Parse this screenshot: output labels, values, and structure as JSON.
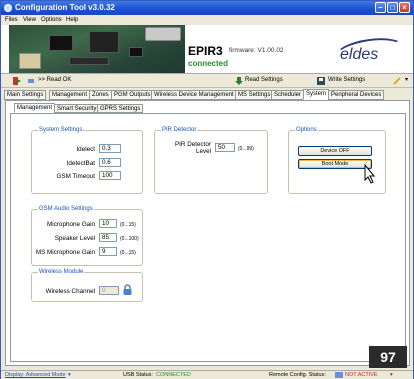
{
  "window": {
    "title": "Configuration Tool v3.0.32"
  },
  "menu": [
    "Files",
    "View",
    "Options",
    "Help"
  ],
  "banner": {
    "device_name": "EPIR3",
    "firmware": "firmware: V1.00.02",
    "connection": "connected",
    "logo": "eldes"
  },
  "toolbar": {
    "status": ">> Read OK",
    "read_settings": "Read Settings",
    "write_settings": "Write Settings"
  },
  "tabs": [
    "Main Settings",
    "Management",
    "Zones",
    "PGM Outputs",
    "Wireless Device Management",
    "MS Settings",
    "Scheduler",
    "System",
    "Peripheral Devices"
  ],
  "subtabs": [
    "Management",
    "Smart Security",
    "GPRS Settings"
  ],
  "system_settings": {
    "legend": "System Settings",
    "fields": [
      {
        "label": "Idelect",
        "value": "0.3"
      },
      {
        "label": "IdetectBat",
        "value": "0.6"
      },
      {
        "label": "GSM Timeout",
        "value": "100"
      }
    ]
  },
  "pir_detector": {
    "legend": "PIR Detector",
    "label_line1": "PIR Detector",
    "label_line2": "Level",
    "value": "50",
    "range": "(0...99)"
  },
  "options": {
    "legend": "Options",
    "device_off": "Device OFF",
    "boot_mode": "Boot Mode"
  },
  "gsm_audio": {
    "legend": "GSM Audio Settings",
    "fields": [
      {
        "label": "Microphone Gain",
        "value": "10",
        "range": "(0...15)"
      },
      {
        "label": "Speaker Level",
        "value": "85",
        "range": "(0...100)"
      },
      {
        "label": "MS Microphone Gain",
        "value": "9",
        "range": "(0...15)"
      }
    ]
  },
  "wireless_module": {
    "legend": "Wireless Module",
    "label": "Wireless Channel",
    "value": "0"
  },
  "statusbar": {
    "display": "Display: Advanced Mode",
    "usb_label": "USB Status:",
    "usb_value": "CONNECTED",
    "remote_label": "Remote Config. Status:",
    "remote_value": "NOT ACTIVE"
  },
  "page_number": "97",
  "colors": {
    "accent": "#1b4fbf",
    "connected": "#2a8a2a",
    "not_active": "#d0261a"
  }
}
